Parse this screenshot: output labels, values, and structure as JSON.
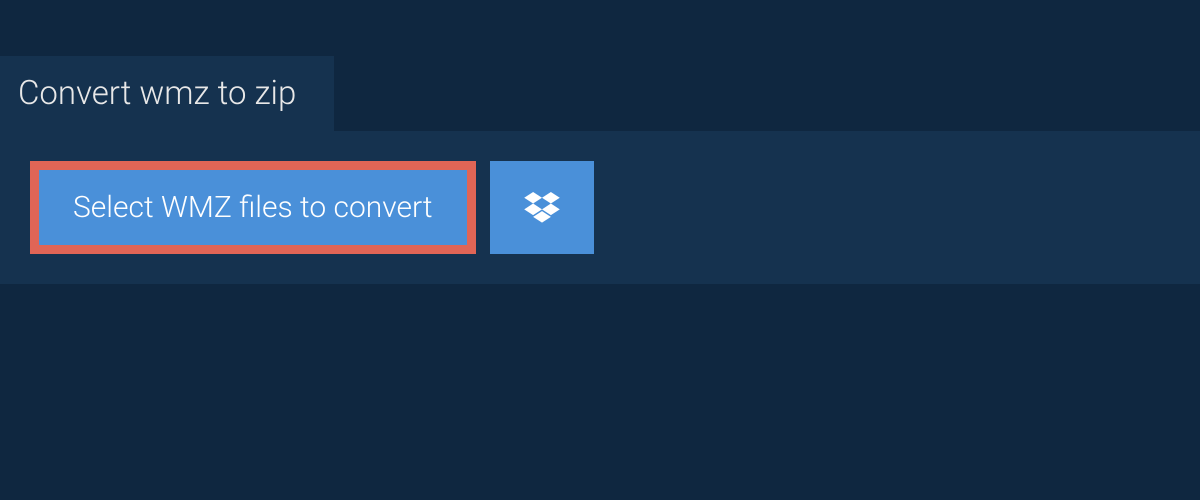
{
  "tab": {
    "title": "Convert wmz to zip"
  },
  "actions": {
    "select_label": "Select WMZ files to convert"
  },
  "colors": {
    "background": "#0f2740",
    "panel": "#15324f",
    "button": "#4a90d9",
    "highlight_border": "#e06556"
  }
}
